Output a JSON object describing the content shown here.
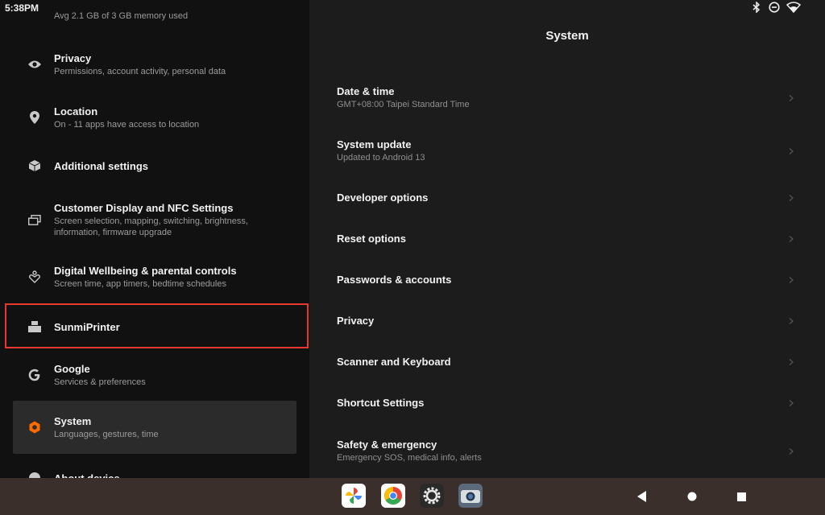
{
  "status_bar": {
    "time": "5:38PM"
  },
  "left_panel": {
    "top_cut_text": "Avg 2.1 GB of 3 GB memory used",
    "items": [
      {
        "icon": "eye-icon",
        "title": "Privacy",
        "subtitle": "Permissions, account activity, personal data"
      },
      {
        "icon": "location-pin-icon",
        "title": "Location",
        "subtitle": "On - 11 apps have access to location"
      },
      {
        "icon": "cube-icon",
        "title": "Additional settings",
        "subtitle": ""
      },
      {
        "icon": "displays-icon",
        "title": "Customer Display and NFC Settings",
        "subtitle": "Screen selection, mapping, switching, brightness, information, firmware upgrade"
      },
      {
        "icon": "wellbeing-icon",
        "title": "Digital Wellbeing & parental controls",
        "subtitle": "Screen time, app timers, bedtime schedules"
      },
      {
        "icon": "printer-icon",
        "title": "SunmiPrinter",
        "subtitle": ""
      },
      {
        "icon": "google-icon",
        "title": "Google",
        "subtitle": "Services & preferences"
      },
      {
        "icon": "system-hex-icon",
        "title": "System",
        "subtitle": "Languages, gestures, time"
      },
      {
        "icon": "info-icon",
        "title": "About device",
        "subtitle": ""
      }
    ]
  },
  "right_panel": {
    "title": "System",
    "items": [
      {
        "title": "Date & time",
        "subtitle": "GMT+08:00 Taipei Standard Time"
      },
      {
        "title": "System update",
        "subtitle": "Updated to Android 13"
      },
      {
        "title": "Developer options",
        "subtitle": ""
      },
      {
        "title": "Reset options",
        "subtitle": ""
      },
      {
        "title": "Passwords & accounts",
        "subtitle": ""
      },
      {
        "title": "Privacy",
        "subtitle": ""
      },
      {
        "title": "Scanner and Keyboard",
        "subtitle": ""
      },
      {
        "title": "Shortcut Settings",
        "subtitle": ""
      },
      {
        "title": "Safety & emergency",
        "subtitle": "Emergency SOS, medical info, alerts"
      }
    ]
  },
  "taskbar": {
    "apps": [
      "photos-icon",
      "chrome-icon",
      "settings-gear-icon",
      "camera-icon"
    ],
    "nav": [
      "back-icon",
      "home-icon",
      "recents-icon"
    ]
  },
  "colors": {
    "selected_accent": "#ff6a00",
    "highlight_border": "#e8372c",
    "navbar": "#3a2f2a"
  }
}
